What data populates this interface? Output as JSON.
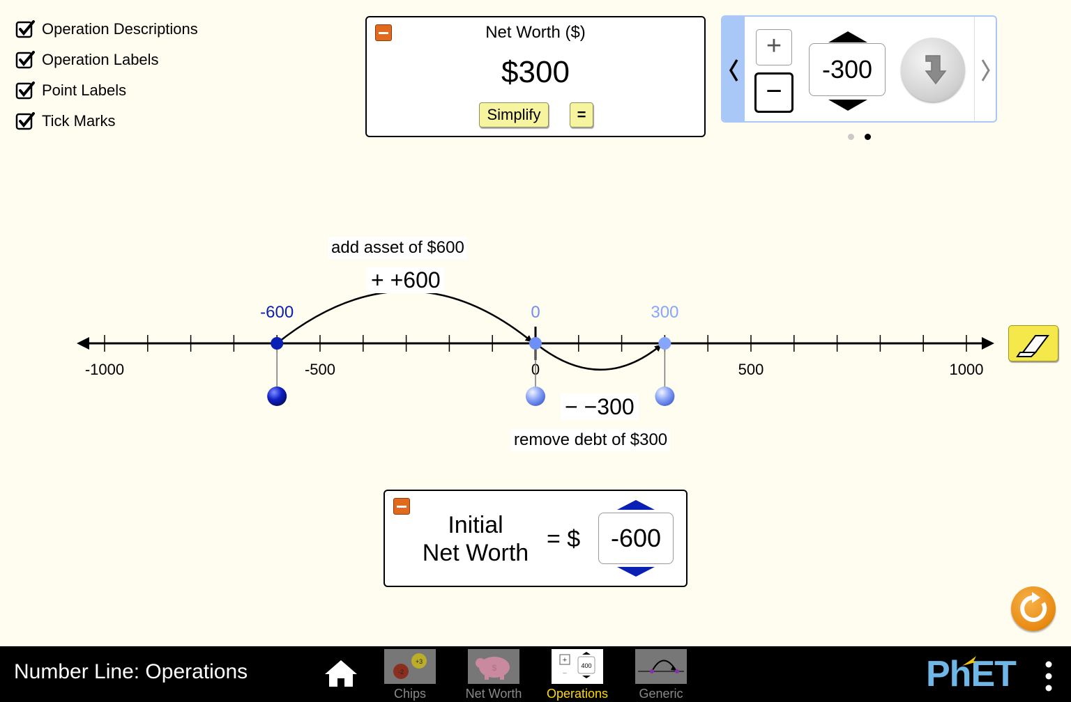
{
  "checkboxes": [
    {
      "label": "Operation Descriptions",
      "checked": true
    },
    {
      "label": "Operation Labels",
      "checked": true
    },
    {
      "label": "Point Labels",
      "checked": true
    },
    {
      "label": "Tick Marks",
      "checked": true
    }
  ],
  "net_worth_panel": {
    "title": "Net Worth ($)",
    "value": "$300",
    "simplify_label": "Simplify",
    "equals_label": "="
  },
  "operation_entry": {
    "plus_label": "+",
    "minus_label": "−",
    "value": "-300",
    "page_count": 2,
    "active_page": 2
  },
  "number_line": {
    "min": -1000,
    "max": 1000,
    "tick_step": 100,
    "tick_labels": [
      "-1000",
      "-500",
      "0",
      "500",
      "1000"
    ],
    "points": [
      {
        "value": -600,
        "label": "-600",
        "color": "#0a1fb4"
      },
      {
        "value": 0,
        "label": "0",
        "color": "#6e8ff5"
      },
      {
        "value": 300,
        "label": "300",
        "color": "#86a6fb"
      }
    ],
    "operations": [
      {
        "from": -600,
        "to": 0,
        "label": "+ +600",
        "description": "add asset of $600"
      },
      {
        "from": 0,
        "to": 300,
        "label": "− −300",
        "description": "remove debt of $300"
      }
    ]
  },
  "initial_panel": {
    "label_line1": "Initial",
    "label_line2": "Net Worth",
    "equals": "= $",
    "value": "-600"
  },
  "colors": {
    "background": "#fffdf0",
    "accent_orange": "#e26a1f",
    "spinner_blue": "#0a1fb4",
    "carousel_tab": "#a9c8f7"
  },
  "nav": {
    "title": "Number Line: Operations",
    "tabs": [
      {
        "label": "Chips",
        "active": false
      },
      {
        "label": "Net Worth",
        "active": false
      },
      {
        "label": "Operations",
        "active": true
      },
      {
        "label": "Generic",
        "active": false
      }
    ],
    "thumb_operations_value": "400",
    "logo_text": "PhET",
    "chip_values": [
      "-2",
      "+3"
    ]
  }
}
